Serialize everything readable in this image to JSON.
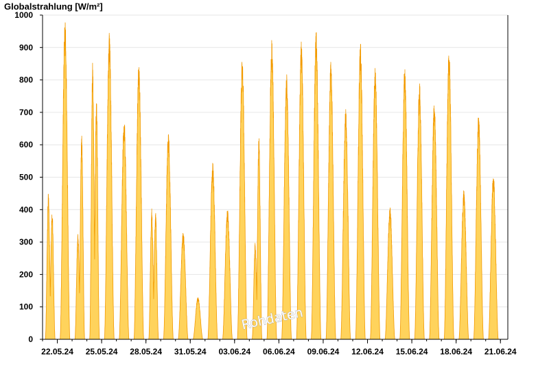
{
  "chart_data": {
    "type": "area",
    "title": "",
    "ylabel": "Globalstrahlung [W/m²]",
    "xlabel": "",
    "ylim": [
      0,
      1000
    ],
    "yticks": [
      0,
      100,
      200,
      300,
      400,
      500,
      600,
      700,
      800,
      900,
      1000
    ],
    "xlim": [
      "2024-05-21T00:00",
      "2024-06-21T12:00"
    ],
    "xtick_labels": [
      "22.05.24",
      "25.05.24",
      "28.05.24",
      "31.05.24",
      "03.06.24",
      "06.06.24",
      "09.06.24",
      "12.06.24",
      "15.06.24",
      "18.06.24",
      "21.06.24"
    ],
    "grid": true,
    "watermark": "Rohdaten",
    "colors": {
      "fill": "#ffd35c",
      "line": "#f29a00",
      "grid": "#e6e6e6"
    },
    "series": [
      {
        "daily_peaks": [
          {
            "date": "2024-05-21",
            "peaks": [
              450,
              400
            ]
          },
          {
            "date": "2024-05-22",
            "peaks": [
              985
            ]
          },
          {
            "date": "2024-05-23",
            "peaks": [
              330,
              630
            ]
          },
          {
            "date": "2024-05-24",
            "peaks": [
              860,
              745
            ]
          },
          {
            "date": "2024-05-25",
            "peaks": [
              950
            ]
          },
          {
            "date": "2024-05-26",
            "peaks": [
              680
            ]
          },
          {
            "date": "2024-05-27",
            "peaks": [
              855
            ]
          },
          {
            "date": "2024-05-28",
            "peaks": [
              405,
              395
            ]
          },
          {
            "date": "2024-05-29",
            "peaks": [
              640
            ]
          },
          {
            "date": "2024-05-30",
            "peaks": [
              330
            ]
          },
          {
            "date": "2024-05-31",
            "peaks": [
              130
            ]
          },
          {
            "date": "2024-06-01",
            "peaks": [
              545
            ]
          },
          {
            "date": "2024-06-02",
            "peaks": [
              400
            ]
          },
          {
            "date": "2024-06-03",
            "peaks": [
              870
            ]
          },
          {
            "date": "2024-06-04",
            "peaks": [
              300,
              630
            ]
          },
          {
            "date": "2024-06-05",
            "peaks": [
              930
            ]
          },
          {
            "date": "2024-06-06",
            "peaks": [
              820
            ]
          },
          {
            "date": "2024-06-07",
            "peaks": [
              920
            ]
          },
          {
            "date": "2024-06-08",
            "peaks": [
              960
            ]
          },
          {
            "date": "2024-06-09",
            "peaks": [
              860
            ]
          },
          {
            "date": "2024-06-10",
            "peaks": [
              710
            ]
          },
          {
            "date": "2024-06-11",
            "peaks": [
              920
            ]
          },
          {
            "date": "2024-06-12",
            "peaks": [
              845
            ]
          },
          {
            "date": "2024-06-13",
            "peaks": [
              410
            ]
          },
          {
            "date": "2024-06-14",
            "peaks": [
              845
            ]
          },
          {
            "date": "2024-06-15",
            "peaks": [
              790
            ]
          },
          {
            "date": "2024-06-16",
            "peaks": [
              735
            ]
          },
          {
            "date": "2024-06-17",
            "peaks": [
              900
            ]
          },
          {
            "date": "2024-06-18",
            "peaks": [
              460
            ]
          },
          {
            "date": "2024-06-19",
            "peaks": [
              695
            ]
          },
          {
            "date": "2024-06-20",
            "peaks": [
              515
            ]
          }
        ]
      }
    ]
  }
}
